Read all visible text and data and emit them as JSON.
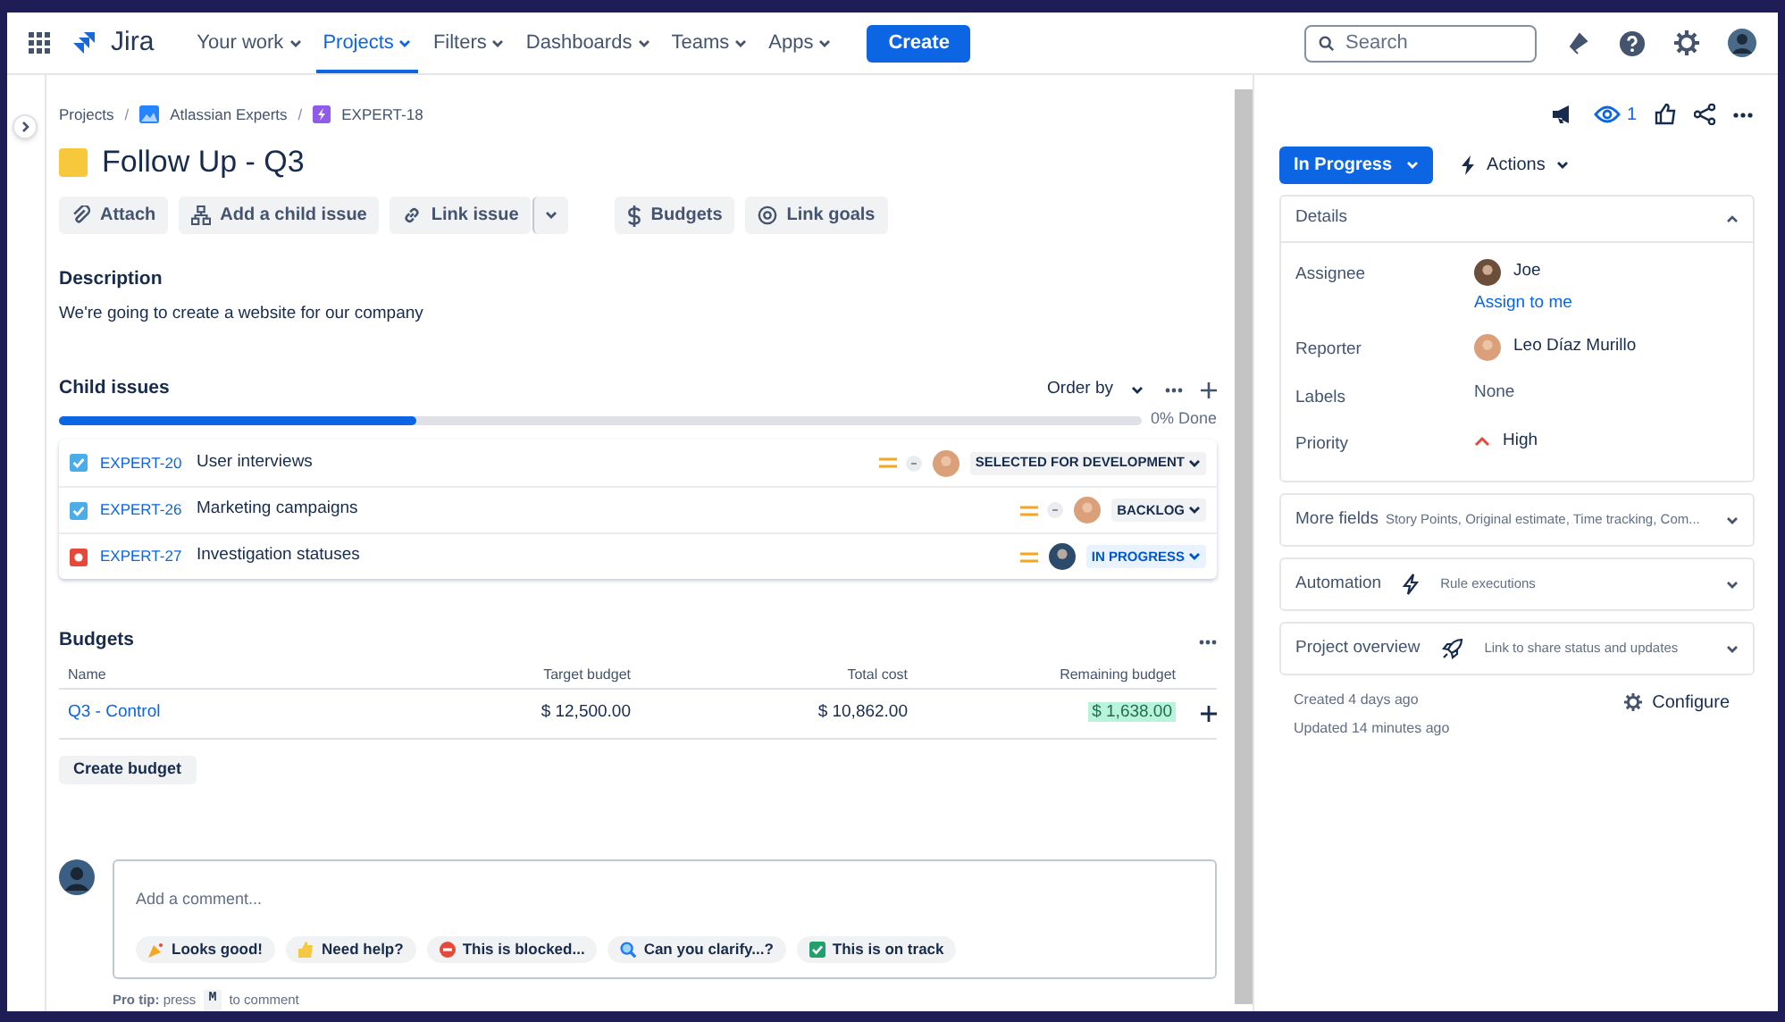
{
  "nav": {
    "items": [
      {
        "label": "Your work",
        "selected": false
      },
      {
        "label": "Projects",
        "selected": true
      },
      {
        "label": "Filters",
        "selected": false
      },
      {
        "label": "Dashboards",
        "selected": false
      },
      {
        "label": "Teams",
        "selected": false
      },
      {
        "label": "Apps",
        "selected": false
      }
    ],
    "logo": "Jira",
    "create": "Create",
    "search": {
      "placeholder": "Search"
    }
  },
  "breadcrumbs": [
    {
      "label": "Projects",
      "separator": "/"
    },
    {
      "label": "Atlassian Experts",
      "separator": "/"
    },
    {
      "label": "EXPERT-18"
    }
  ],
  "title": "Follow Up - Q3",
  "toolbar": [
    "Attach",
    "Add a child issue",
    "Link issue",
    "Budgets",
    "Link goals"
  ],
  "description": {
    "heading": "Description",
    "text": "We're going to create a website for our company"
  },
  "child_issues": {
    "heading": "Child issues",
    "order_by": "Order by",
    "level": 0.33,
    "done": "0% Done",
    "items": [
      {
        "kind": "task",
        "key": "EXPERT-20",
        "summary": "User interviews",
        "status": "SELECTED FOR DEVELOPMENT",
        "in_progress": false
      },
      {
        "kind": "task",
        "key": "EXPERT-26",
        "summary": "Marketing campaigns",
        "status": "BACKLOG",
        "in_progress": false
      },
      {
        "kind": "bug",
        "key": "EXPERT-27",
        "summary": "Investigation statuses",
        "status": "IN PROGRESS",
        "in_progress": true
      }
    ]
  },
  "budgets": {
    "heading": "Budgets",
    "columns": [
      "Name",
      "Target budget",
      "Total cost",
      "Remaining budget"
    ],
    "rows": [
      {
        "name": "Q3 - Control",
        "target": "$ 12,500.00",
        "total": "$ 10,862.00",
        "remaining": "$ 1,638.00"
      }
    ],
    "create": "Create budget"
  },
  "comment": {
    "placeholder": "Add a comment...",
    "quick_replies": [
      {
        "kind": "party",
        "label": "Looks good!"
      },
      {
        "kind": "thumb",
        "label": "Need help?"
      },
      {
        "kind": "blocked",
        "label": "This is blocked..."
      },
      {
        "kind": "search",
        "label": "Can you clarify...?"
      },
      {
        "kind": "check",
        "label": "This is on track"
      }
    ],
    "tip": "**Pro tip:** press",
    "key": "M",
    "tip_end": "to comment"
  },
  "side": {
    "watchers": "1",
    "status": "In Progress",
    "actions": "Actions",
    "details": "Details",
    "fields": [
      {
        "label": "Assignee",
        "value": "Joe",
        "kind": "user",
        "link": "Assign to me"
      },
      {
        "label": "Reporter",
        "value": "Leo Díaz Murillo",
        "kind": "user"
      },
      {
        "label": "Labels",
        "value": "None",
        "kind": "text"
      },
      {
        "label": "Priority",
        "value": "High",
        "kind": "priority"
      }
    ],
    "sections": [
      {
        "kind": "fields",
        "title": "More fields",
        "summary": "Story Points, Original estimate, Time tracking, Com..."
      },
      {
        "kind": "automation",
        "title": "Automation",
        "summary": "Rule executions"
      },
      {
        "kind": "overview",
        "title": "Project overview",
        "summary": "Link to share status and updates"
      }
    ],
    "created": "Created 4 days ago",
    "updated": "Updated 14 minutes ago",
    "configure": "Configure"
  }
}
